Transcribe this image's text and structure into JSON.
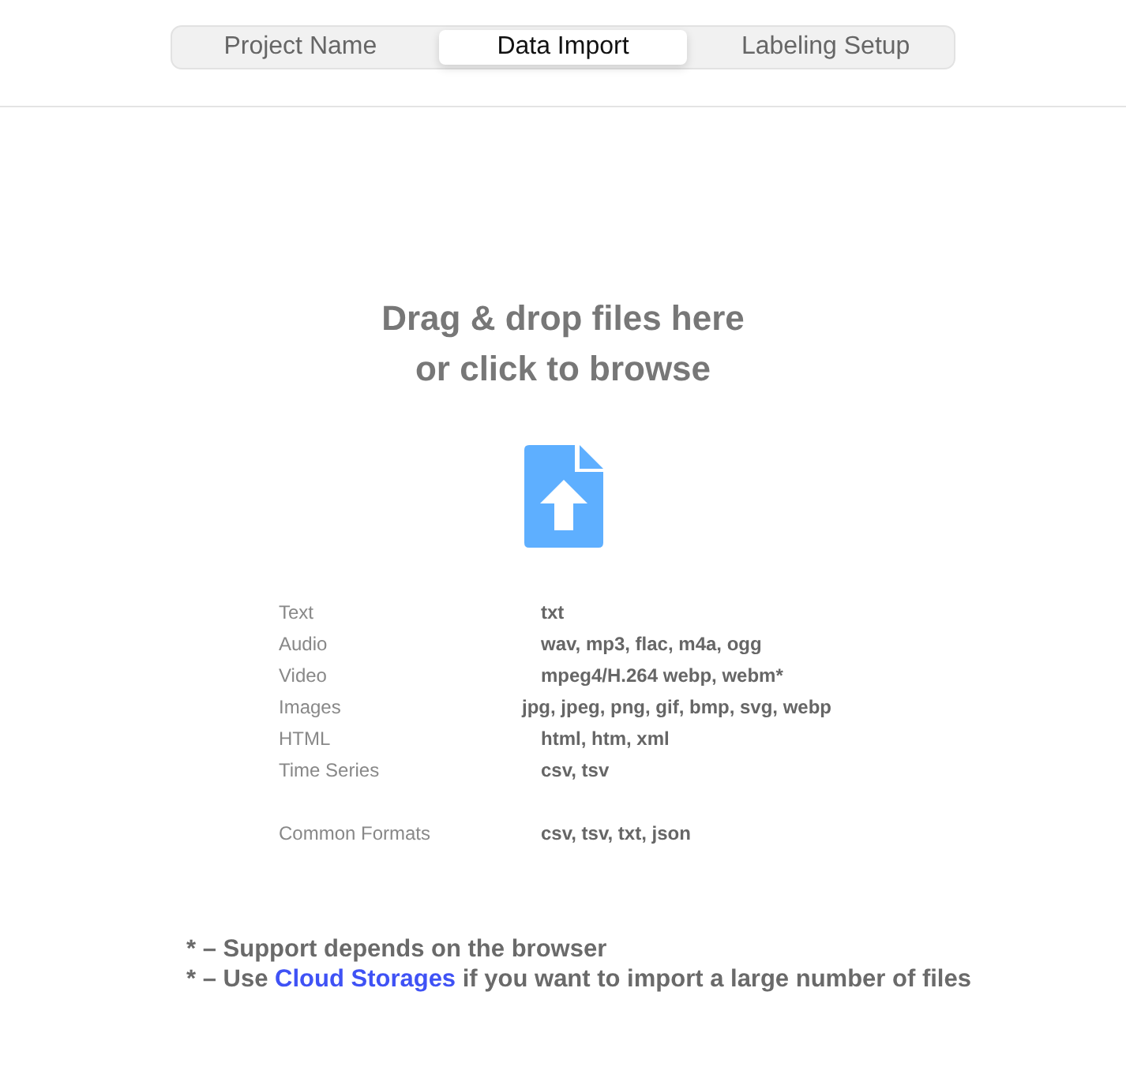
{
  "tabs": [
    {
      "label": "Project Name",
      "selected": false
    },
    {
      "label": "Data Import",
      "selected": true
    },
    {
      "label": "Labeling Setup",
      "selected": false
    }
  ],
  "dropzone": {
    "heading": [
      "Drag & drop files here",
      "or click to browse"
    ]
  },
  "formats": [
    [
      {
        "type": "Text",
        "extensions": "txt"
      },
      {
        "type": "Audio",
        "extensions": "wav, mp3, flac, m4a, ogg"
      },
      {
        "type": "Video",
        "extensions": "mpeg4/H.264 webp, webm*"
      },
      {
        "type": "Images",
        "extensions": "jpg, jpeg, png, gif, bmp, svg, webp"
      },
      {
        "type": "HTML",
        "extensions": "html, htm, xml"
      },
      {
        "type": "Time Series",
        "extensions": "csv, tsv"
      }
    ],
    [
      {
        "type": "Common Formats",
        "extensions": "csv, tsv, txt, json"
      }
    ]
  ],
  "notes": [
    {
      "text": "* – Support depends on the browser"
    },
    {
      "text": "* – Use ",
      "link": "Cloud Storages",
      "after": " if you want to import a large number of files"
    }
  ]
}
